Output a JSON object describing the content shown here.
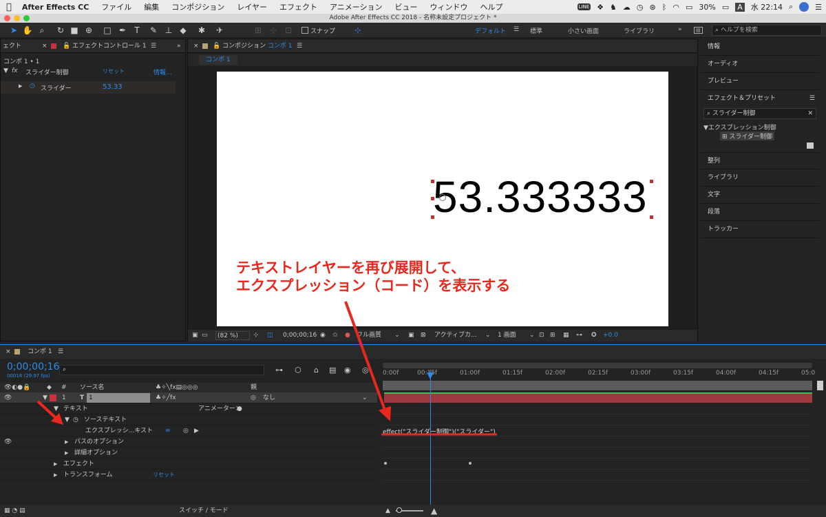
{
  "menubar": {
    "app": "After Effects CC",
    "items": [
      "ファイル",
      "編集",
      "コンポジション",
      "レイヤー",
      "エフェクト",
      "アニメーション",
      "ビュー",
      "ウィンドウ",
      "ヘルプ"
    ],
    "battery": "30%",
    "input": "A",
    "clock": "水 22:14"
  },
  "window": {
    "title": "Adobe After Effects CC 2018 - 名称未設定プロジェクト *"
  },
  "toolbar": {
    "snap_label": "スナップ",
    "workspaces": [
      "デフォルト",
      "標準",
      "小さい画面",
      "ライブラリ"
    ],
    "search_placeholder": "ヘルプを検索"
  },
  "effect_panel": {
    "left_tab": "ェクト",
    "tab": "エフェクトコントロール 1",
    "breadcrumb": "コンポ 1 • 1",
    "effect_name": "スライダー制御",
    "reset": "リセット",
    "info": "情報...",
    "prop_name": "スライダー",
    "prop_value": "53.33"
  },
  "comp_panel": {
    "tab": "コンポジション",
    "tab_comp": "コンポ 1",
    "subtab": "コンポ 1",
    "display_value": "53.333333",
    "zoom": "(82 %)",
    "timecode": "0;00;00;16",
    "quality": "フル画質",
    "camera": "アクティブカ...",
    "views": "1 画面",
    "exposure": "+0.0"
  },
  "annotation": {
    "line1": "テキストレイヤーを再び展開して、",
    "line2": "エクスプレッション（コード）を表示する",
    "color": "#e8281e"
  },
  "right_panel": {
    "info": "情報",
    "audio": "オーディオ",
    "preview": "プレビュー",
    "effects_presets": "エフェクト＆プリセット",
    "search_value": "スライダー制御",
    "category": "▼エクスプレッション制御",
    "result": "スライダー制御",
    "align": "整列",
    "library": "ライブラリ",
    "character": "文字",
    "paragraph": "段落",
    "tracker": "トラッカー"
  },
  "timeline": {
    "tab": "コンポ 1",
    "timecode": "0;00;00;16",
    "frames": "00016 (29.97 fps)",
    "source_col": "ソース名",
    "parent_col": "親",
    "layer_num": "1",
    "layer_type": "T",
    "layer_name": "1",
    "parent_value": "なし",
    "text": "テキスト",
    "animator": "アニメーター：",
    "source_text": "ソーステキスト",
    "expression": "エクスプレッシ...キスト",
    "path_options": "パスのオプション",
    "more_options": "詳細オプション",
    "effects": "エフェクト",
    "transform": "トランスフォーム",
    "transform_reset": "リセット",
    "expression_code": "effect(\"スライダー制御\")(\"スライダー\")",
    "switches": "スイッチ / モード",
    "ruler": [
      "0:00f",
      "00:15f",
      "01:00f",
      "01:15f",
      "02:00f",
      "02:15f",
      "03:00f",
      "03:15f",
      "04:00f",
      "04:15f",
      "05:0"
    ]
  },
  "colors": {
    "accent": "#2d8ceb",
    "layer_bar": "#9e3a3f",
    "label_red": "#c8323c"
  }
}
